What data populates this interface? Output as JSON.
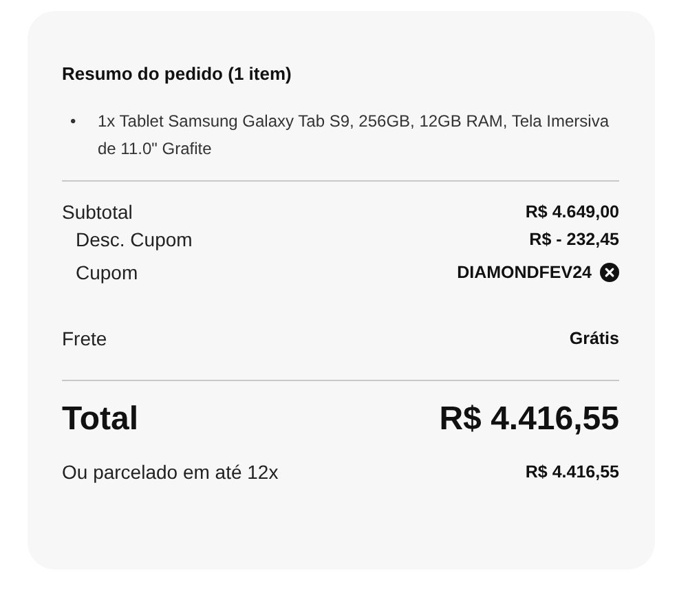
{
  "summary": {
    "title": "Resumo do pedido (1 item)",
    "items": [
      {
        "bullet": "•",
        "text": "1x Tablet Samsung Galaxy Tab S9, 256GB, 12GB RAM, Tela Imersiva de 11.0\" Grafite"
      }
    ],
    "lines": [
      {
        "kind": "amount",
        "label": "Subtotal",
        "value": "R$ 4.649,00",
        "indented": false
      },
      {
        "kind": "amount",
        "label": "Desc. Cupom",
        "value": "R$ - 232,45",
        "indented": true
      },
      {
        "kind": "coupon",
        "label": "Cupom",
        "value": "DIAMONDFEV24",
        "indented": true
      }
    ],
    "shipping": {
      "label": "Frete",
      "value": "Grátis"
    },
    "total": {
      "label": "Total",
      "value": "R$ 4.416,55"
    },
    "installments": {
      "label": "Ou parcelado em até 12x",
      "value": "R$ 4.416,55"
    }
  }
}
